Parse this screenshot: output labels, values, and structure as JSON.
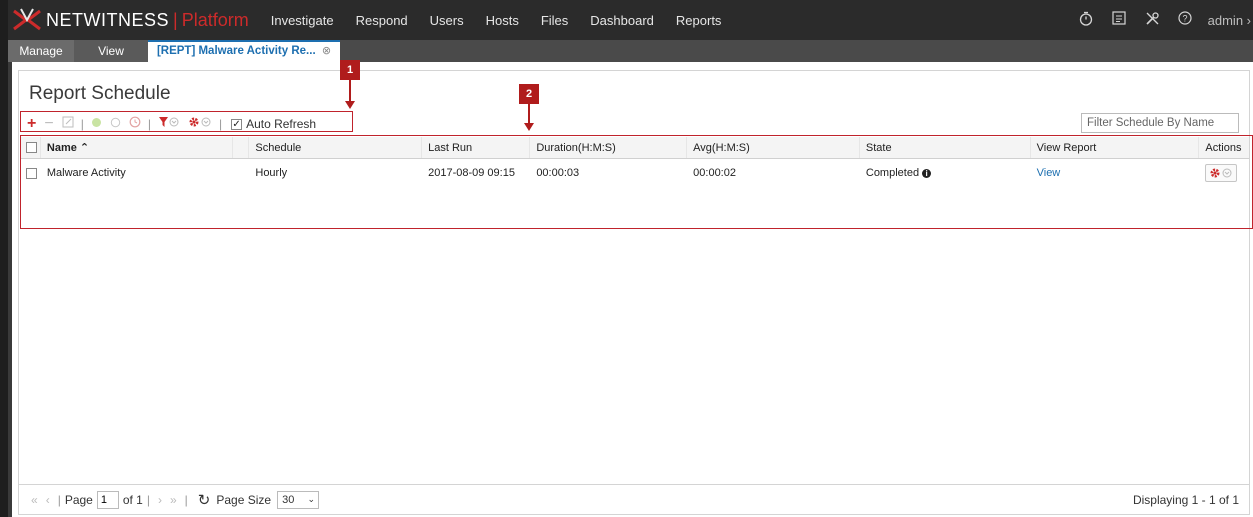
{
  "topnav": {
    "brand": "NETWITNESS",
    "separator": "|",
    "product": "Platform",
    "items": [
      "Investigate",
      "Respond",
      "Users",
      "Hosts",
      "Files",
      "Dashboard",
      "Reports"
    ],
    "icons": [
      "timer-icon",
      "tasks-icon",
      "tools-icon",
      "help-icon"
    ],
    "user": "admin ›"
  },
  "subnav": {
    "tabs": [
      "Manage",
      "View"
    ],
    "active_tab": "[REPT] Malware Activity Re...",
    "close_glyph": "⊗"
  },
  "panel": {
    "title": "Report Schedule",
    "filter_placeholder": "Filter Schedule By Name",
    "auto_refresh_label": "Auto Refresh"
  },
  "toolbar": {
    "icons": [
      "add-icon",
      "remove-icon",
      "edit-icon",
      "enable-icon",
      "disable-icon",
      "history-icon",
      "filter-icon",
      "settings-icon"
    ],
    "colors": {
      "add": "#cc2b2b",
      "disabled": "#bdbdbd",
      "enabled_dot": "#8cc63e"
    }
  },
  "grid": {
    "columns": [
      "Name ⌃",
      "Schedule",
      "Last Run",
      "Duration(H:M:S)",
      "Avg(H:M:S)",
      "State",
      "View Report",
      "Actions"
    ],
    "rows": [
      {
        "name": "Malware Activity",
        "schedule": "Hourly",
        "last_run": "2017-08-09 09:15",
        "duration": "00:00:03",
        "avg": "00:00:02",
        "state": "Completed",
        "view": "View"
      }
    ]
  },
  "callouts": [
    "1",
    "2"
  ],
  "pager": {
    "page_label": "Page",
    "page_value": "1",
    "of_label": "of 1",
    "page_size_label": "Page Size",
    "page_size_value": "30",
    "display": "Displaying 1 - 1 of 1"
  }
}
